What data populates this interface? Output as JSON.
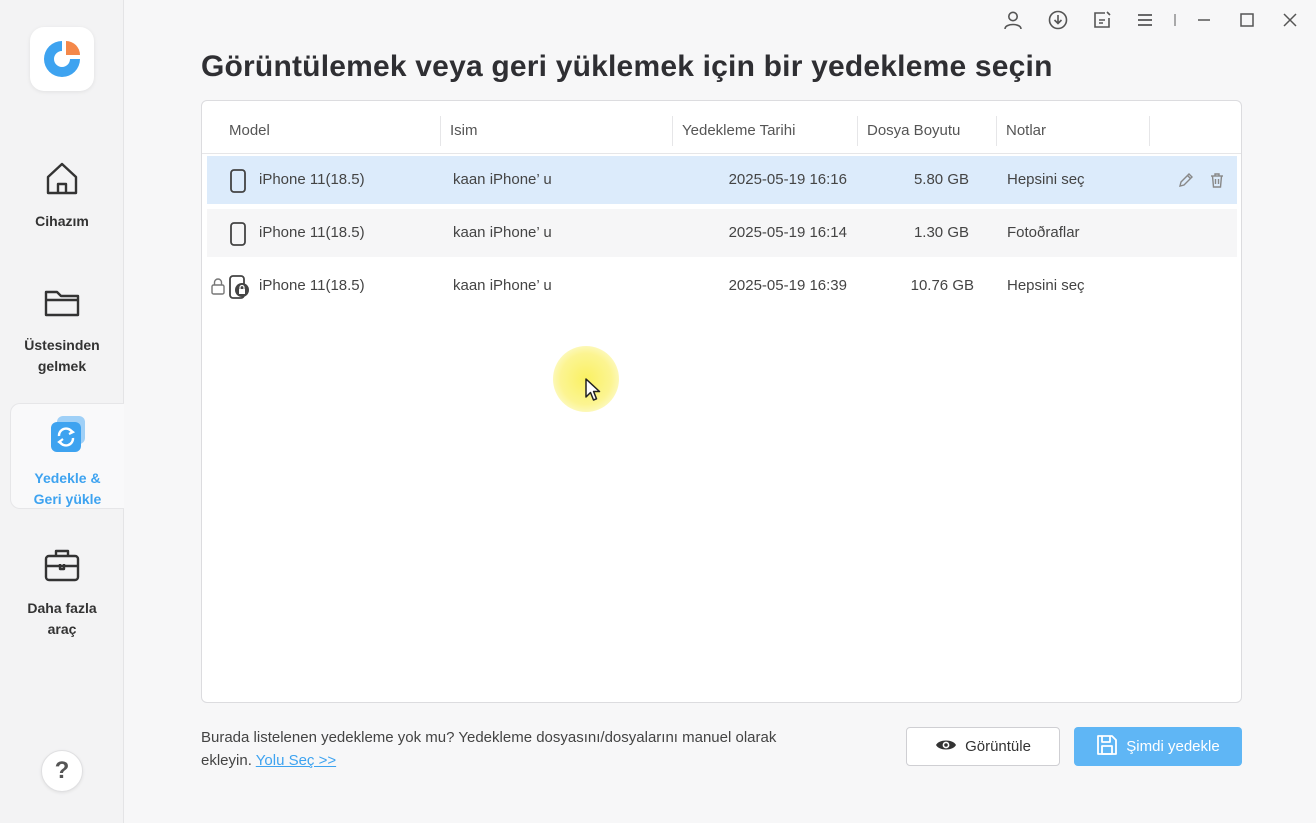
{
  "sidebar": {
    "logo_icon": "app-logo-icon",
    "items": [
      {
        "label": "Cihazım",
        "icon": "home-icon",
        "active": false
      },
      {
        "label": "Üstesinden\ngelmek",
        "icon": "folder-icon",
        "active": false
      },
      {
        "label": "Yedekle &\nGeri yükle",
        "icon": "backup-restore-icon",
        "active": true
      },
      {
        "label": "Daha fazla\naraç",
        "icon": "toolbox-icon",
        "active": false
      }
    ],
    "help_label": "?"
  },
  "titlebar": {
    "icons": [
      "account-icon",
      "download-icon",
      "feedback-icon",
      "menu-icon",
      "minimize-icon",
      "maximize-icon",
      "close-icon"
    ]
  },
  "main": {
    "title": "Görüntülemek veya geri yüklemek için bir yedekleme seçin",
    "table": {
      "columns": [
        "Model",
        "Isim",
        "Yedekleme Tarihi",
        "Dosya Boyutu",
        "Notlar"
      ],
      "rows": [
        {
          "model": "iPhone 11(18.5)",
          "name": "kaan iPhone’ u",
          "date": "2025-05-19 16:16",
          "size": "5.80 GB",
          "notes": "Hepsini seç",
          "selected": true,
          "locked": false
        },
        {
          "model": "iPhone 11(18.5)",
          "name": "kaan iPhone’ u",
          "date": "2025-05-19 16:14",
          "size": "1.30 GB",
          "notes": "Fotoðraflar",
          "selected": false,
          "locked": false
        },
        {
          "model": "iPhone 11(18.5)",
          "name": "kaan iPhone’ u",
          "date": "2025-05-19 16:39",
          "size": "10.76 GB",
          "notes": "Hepsini seç",
          "selected": false,
          "locked": true
        }
      ]
    }
  },
  "footer": {
    "text": "Burada listelenen yedekleme yok mu? Yedekleme dosyasını/dosyalarını manuel olarak ekleyin.",
    "link": "Yolu Seç >>",
    "view_button": "Görüntüle",
    "backup_button": "Şimdi yedekle"
  },
  "colors": {
    "accent": "#3ea3f0",
    "selected_row": "#dcebfb",
    "primary_button": "#5fb6f5"
  }
}
